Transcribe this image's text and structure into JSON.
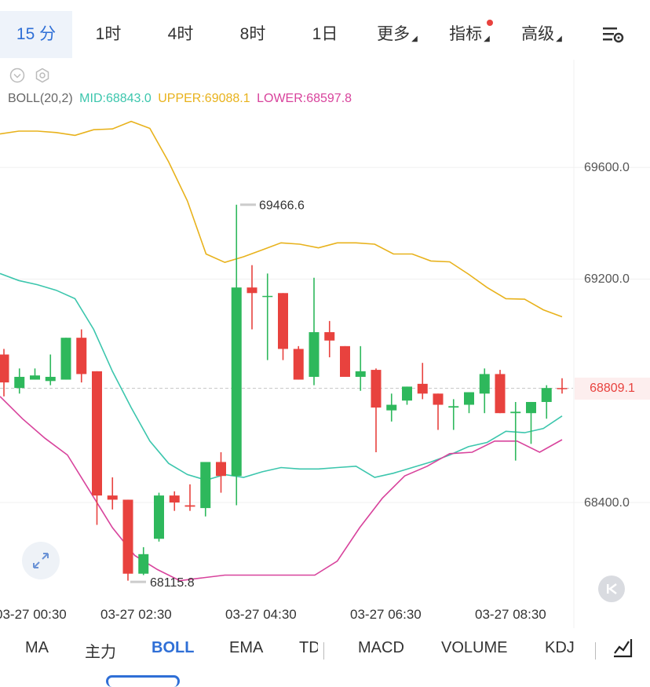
{
  "timeframe_tabs": [
    {
      "label": "15 分",
      "active": true
    },
    {
      "label": "1时"
    },
    {
      "label": "4时"
    },
    {
      "label": "8时"
    },
    {
      "label": "1日"
    },
    {
      "label": "更多",
      "dropdown": true
    },
    {
      "label": "指标",
      "dropdown": true,
      "dot": true
    },
    {
      "label": "高级",
      "dropdown": true
    }
  ],
  "legend": {
    "name": "BOLL(20,2)",
    "mid": "MID:68843.0",
    "upper": "UPPER:69088.1",
    "lower": "LOWER:68597.8"
  },
  "colors": {
    "up": "#2eb85c",
    "down": "#e8423e",
    "mid": "#3cc6ad",
    "upper": "#e8b21c",
    "lower": "#d8439c",
    "accent": "#2f6fd6"
  },
  "price_axis": [
    "69600.0",
    "69200.0",
    "68400.0"
  ],
  "current_price": "68809.1",
  "high_label": "69466.6",
  "low_label": "68115.8",
  "time_axis": [
    "03-27 00:30",
    "03-27 02:30",
    "03-27 04:30",
    "03-27 06:30",
    "03-27 08:30"
  ],
  "bottom_tabs": [
    "MA",
    "主力",
    "BOLL",
    "EMA",
    "TD",
    "MACD",
    "VOLUME",
    "KDJ"
  ],
  "active_bottom_tab": "BOLL",
  "chart_data": {
    "type": "candlestick",
    "ylim": [
      68000,
      69900
    ],
    "candles": [
      {
        "open": 68930,
        "high": 68950,
        "low": 68780,
        "close": 68830
      },
      {
        "open": 68810,
        "high": 68880,
        "low": 68790,
        "close": 68850
      },
      {
        "open": 68840,
        "high": 68880,
        "low": 68840,
        "close": 68855
      },
      {
        "open": 68835,
        "high": 68930,
        "low": 68820,
        "close": 68850
      },
      {
        "open": 68840,
        "high": 68990,
        "low": 68840,
        "close": 68990
      },
      {
        "open": 68990,
        "high": 69020,
        "low": 68830,
        "close": 68860
      },
      {
        "open": 68870,
        "high": 68870,
        "low": 68320,
        "close": 68425
      },
      {
        "open": 68425,
        "high": 68490,
        "low": 68375,
        "close": 68410
      },
      {
        "open": 68410,
        "high": 68410,
        "low": 68120,
        "close": 68145
      },
      {
        "open": 68145,
        "high": 68240,
        "low": 68140,
        "close": 68215
      },
      {
        "open": 68270,
        "high": 68435,
        "low": 68260,
        "close": 68425
      },
      {
        "open": 68425,
        "high": 68440,
        "low": 68370,
        "close": 68400
      },
      {
        "open": 68390,
        "high": 68465,
        "low": 68370,
        "close": 68385
      },
      {
        "open": 68380,
        "high": 68540,
        "low": 68350,
        "close": 68545
      },
      {
        "open": 68545,
        "high": 68580,
        "low": 68435,
        "close": 68495
      },
      {
        "open": 68495,
        "high": 69466.6,
        "low": 68390,
        "close": 69170
      },
      {
        "open": 69170,
        "high": 69250,
        "low": 69020,
        "close": 69150
      },
      {
        "open": 69140,
        "high": 69220,
        "low": 68910,
        "close": 69140
      },
      {
        "open": 69150,
        "high": 69150,
        "low": 68910,
        "close": 68950
      },
      {
        "open": 68950,
        "high": 68960,
        "low": 68840,
        "close": 68840
      },
      {
        "open": 68850,
        "high": 69205,
        "low": 68820,
        "close": 69010
      },
      {
        "open": 69010,
        "high": 69050,
        "low": 68920,
        "close": 68980
      },
      {
        "open": 68960,
        "high": 68960,
        "low": 68870,
        "close": 68850
      },
      {
        "open": 68850,
        "high": 68960,
        "low": 68800,
        "close": 68870
      },
      {
        "open": 68875,
        "high": 68880,
        "low": 68580,
        "close": 68740
      },
      {
        "open": 68730,
        "high": 68790,
        "low": 68690,
        "close": 68750
      },
      {
        "open": 68765,
        "high": 68815,
        "low": 68750,
        "close": 68815
      },
      {
        "open": 68825,
        "high": 68900,
        "low": 68770,
        "close": 68790
      },
      {
        "open": 68790,
        "high": 68790,
        "low": 68660,
        "close": 68750
      },
      {
        "open": 68740,
        "high": 68770,
        "low": 68660,
        "close": 68745
      },
      {
        "open": 68750,
        "high": 68795,
        "low": 68720,
        "close": 68795
      },
      {
        "open": 68790,
        "high": 68880,
        "low": 68720,
        "close": 68860
      },
      {
        "open": 68860,
        "high": 68875,
        "low": 68720,
        "close": 68720
      },
      {
        "open": 68720,
        "high": 68760,
        "low": 68550,
        "close": 68725
      },
      {
        "open": 68720,
        "high": 68760,
        "low": 68610,
        "close": 68760
      },
      {
        "open": 68760,
        "high": 68820,
        "low": 68700,
        "close": 68810
      },
      {
        "open": 68810,
        "high": 68845,
        "low": 68790,
        "close": 68809.1
      }
    ],
    "upper": [
      69720,
      69730,
      69730,
      69725,
      69715,
      69735,
      69738,
      69765,
      69740,
      69620,
      69480,
      69290,
      69260,
      69280,
      69305,
      69330,
      69325,
      69312,
      69330,
      69330,
      69325,
      69290,
      69290,
      69265,
      69262,
      69218,
      69170,
      69130,
      69128,
      69090,
      69065
    ],
    "mid": [
      69220,
      69195,
      69180,
      69160,
      69130,
      69020,
      68870,
      68740,
      68620,
      68540,
      68500,
      68480,
      68500,
      68490,
      68510,
      68525,
      68520,
      68520,
      68525,
      68530,
      68490,
      68505,
      68525,
      68545,
      68570,
      68600,
      68615,
      68655,
      68650,
      68665,
      68710
    ],
    "lower": [
      68780,
      68700,
      68630,
      68570,
      68440,
      68310,
      68210,
      68160,
      68120,
      68130,
      68140,
      68140,
      68140,
      68140,
      68140,
      68190,
      68310,
      68415,
      68495,
      68530,
      68575,
      68580,
      68620,
      68620,
      68580,
      68625
    ],
    "dashed_price_line": 68809.1
  }
}
